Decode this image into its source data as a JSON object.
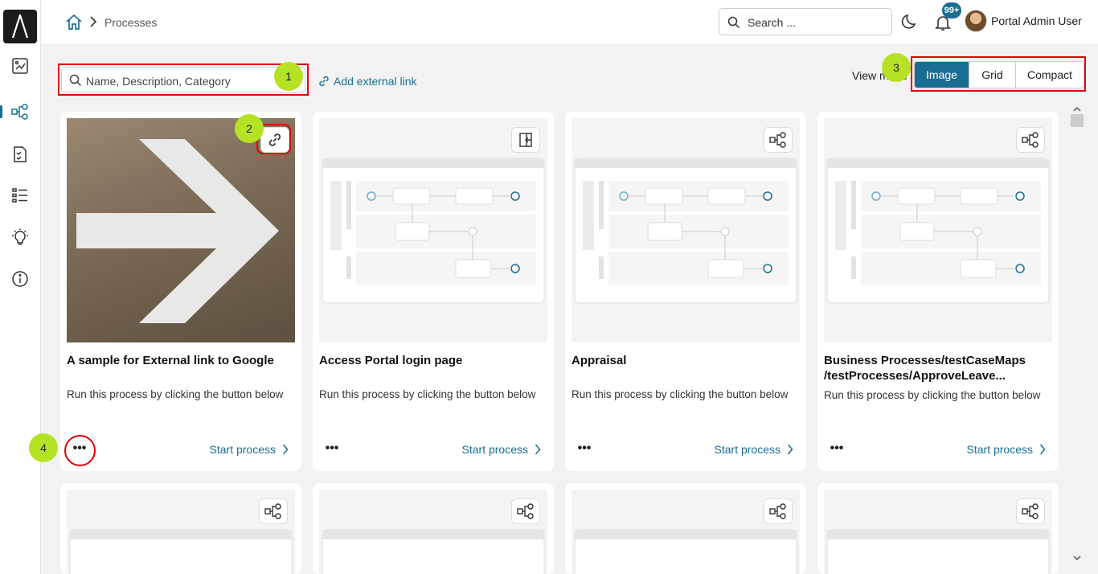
{
  "header": {
    "breadcrumb": "Processes",
    "search_placeholder": "Search ...",
    "notification_count": "99+",
    "user_name": "Portal Admin User"
  },
  "sidebar": {
    "items": [
      {
        "icon": "dashboard-icon"
      },
      {
        "icon": "process-icon",
        "active": true
      },
      {
        "icon": "task-icon"
      },
      {
        "icon": "case-list-icon"
      },
      {
        "icon": "idea-icon"
      },
      {
        "icon": "info-icon"
      }
    ]
  },
  "toolbar": {
    "filter_placeholder": "Name, Description, Category",
    "add_external_link": "Add external link",
    "view_mode_label": "View mode",
    "view_modes": [
      "Image",
      "Grid",
      "Compact"
    ],
    "active_view_mode": "Image"
  },
  "markers": [
    "1",
    "2",
    "3",
    "4"
  ],
  "cards": [
    {
      "title": "A sample for External link to Google",
      "description": "Run this process by clicking the button below",
      "type_icon": "link-icon",
      "more_label": "•••",
      "start_label": "Start process"
    },
    {
      "title": "Access Portal login page",
      "description": "Run this process by clicking the button below",
      "type_icon": "login-icon",
      "more_label": "•••",
      "start_label": "Start process"
    },
    {
      "title": "Appraisal",
      "description": "Run this process by clicking the button below",
      "type_icon": "process-icon",
      "more_label": "•••",
      "start_label": "Start process"
    },
    {
      "title": "Business Processes/testCaseMaps /testProcesses/ApproveLeave...",
      "description": "Run this process by clicking the button below",
      "type_icon": "process-icon",
      "more_label": "•••",
      "start_label": "Start process"
    }
  ],
  "colors": {
    "accent": "#1a6e94",
    "highlight": "#e10000",
    "marker": "#b5e225"
  }
}
